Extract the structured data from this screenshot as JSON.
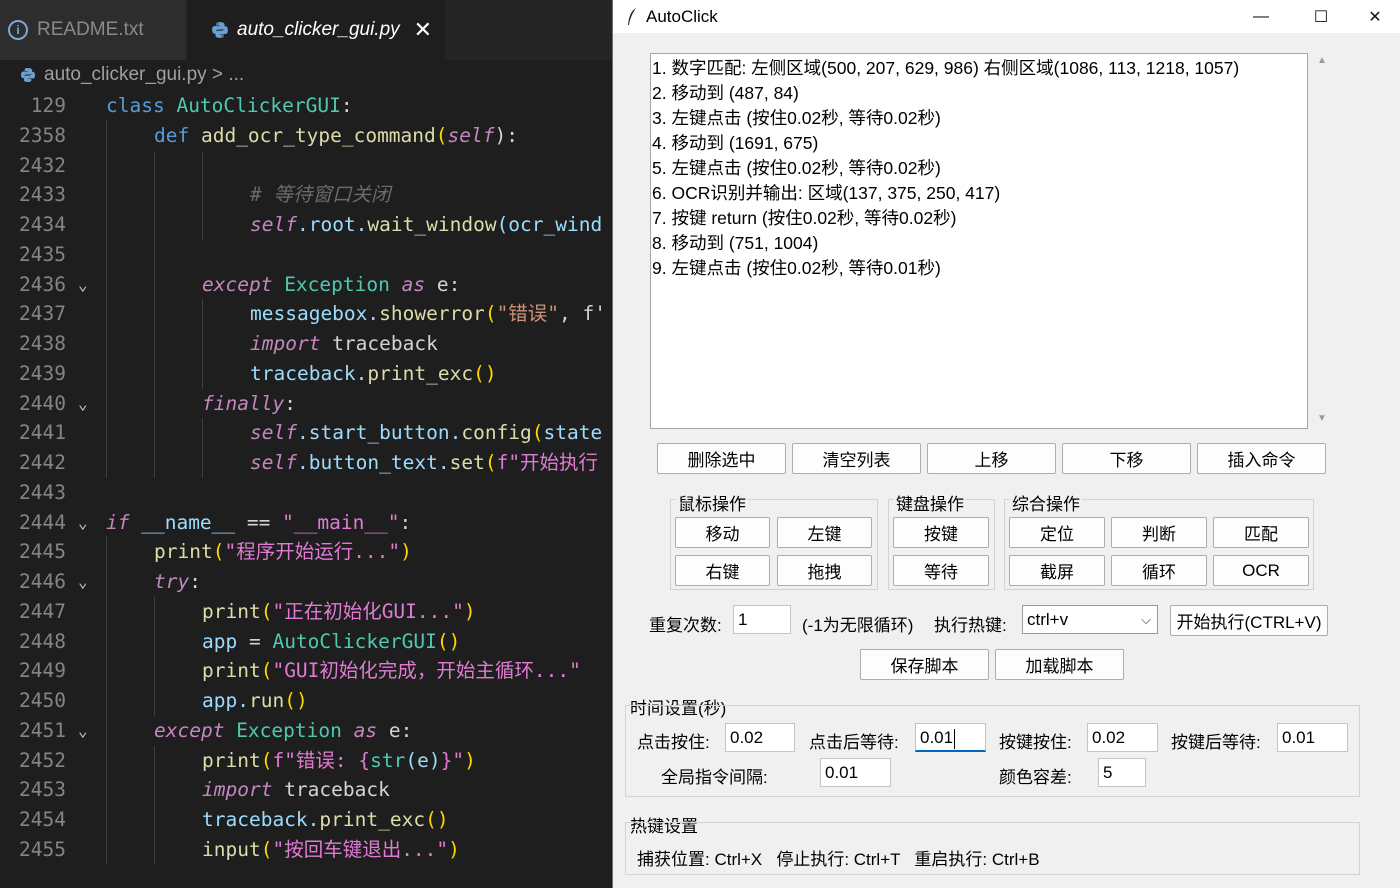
{
  "editor": {
    "tabs": [
      {
        "label": "README.txt"
      },
      {
        "label": "auto_clicker_gui.py"
      }
    ],
    "breadcrumb": {
      "file": "auto_clicker_gui.py",
      "sep": " > ",
      "rest": "..."
    },
    "lines": [
      {
        "num": "129",
        "fold": "",
        "indent": 0,
        "tokens": [
          [
            "class ",
            "c-kw"
          ],
          [
            "AutoClickerGUI",
            "c-cls"
          ],
          [
            ":",
            ""
          ]
        ]
      },
      {
        "num": "2358",
        "fold": "",
        "indent": 1,
        "tokens": [
          [
            "def ",
            "c-kw"
          ],
          [
            "add_ocr_type_command",
            "c-fn"
          ],
          [
            "(",
            "c-par"
          ],
          [
            "self",
            "c-self"
          ],
          [
            "):",
            ""
          ]
        ]
      },
      {
        "num": "2432",
        "fold": "",
        "indent": 3,
        "tokens": []
      },
      {
        "num": "2433",
        "fold": "",
        "indent": 3,
        "tokens": [
          [
            "# 等待窗口关闭",
            "c-cmt"
          ]
        ]
      },
      {
        "num": "2434",
        "fold": "",
        "indent": 3,
        "tokens": [
          [
            "self",
            "c-self"
          ],
          [
            ".root.",
            "c-var"
          ],
          [
            "wait_window",
            "c-fn"
          ],
          [
            "(ocr_wind",
            "c-var"
          ]
        ]
      },
      {
        "num": "2435",
        "fold": "",
        "indent": 2,
        "tokens": []
      },
      {
        "num": "2436",
        "fold": "v",
        "indent": 2,
        "tokens": [
          [
            "except ",
            "c-kwi"
          ],
          [
            "Exception ",
            "c-cls"
          ],
          [
            "as ",
            "c-kwi"
          ],
          [
            "e",
            ""
          ],
          [
            ":",
            ""
          ]
        ]
      },
      {
        "num": "2437",
        "fold": "",
        "indent": 3,
        "tokens": [
          [
            "messagebox.",
            "c-var"
          ],
          [
            "showerror",
            "c-fn"
          ],
          [
            "(",
            "c-par"
          ],
          [
            "\"错误\"",
            "c-str"
          ],
          [
            ", f'",
            ""
          ]
        ]
      },
      {
        "num": "2438",
        "fold": "",
        "indent": 3,
        "tokens": [
          [
            "import ",
            "c-kwi"
          ],
          [
            "traceback",
            ""
          ]
        ]
      },
      {
        "num": "2439",
        "fold": "",
        "indent": 3,
        "tokens": [
          [
            "traceback.",
            "c-var"
          ],
          [
            "print_exc",
            "c-fn"
          ],
          [
            "()",
            "c-par"
          ]
        ]
      },
      {
        "num": "2440",
        "fold": "v",
        "indent": 2,
        "tokens": [
          [
            "finally",
            "c-kwi"
          ],
          [
            ":",
            ""
          ]
        ]
      },
      {
        "num": "2441",
        "fold": "",
        "indent": 3,
        "tokens": [
          [
            "self",
            "c-self"
          ],
          [
            ".start_button.",
            "c-var"
          ],
          [
            "config",
            "c-fn"
          ],
          [
            "(",
            "c-par"
          ],
          [
            "state",
            "c-var"
          ]
        ]
      },
      {
        "num": "2442",
        "fold": "",
        "indent": 3,
        "tokens": [
          [
            "self",
            "c-self"
          ],
          [
            ".button_text.",
            "c-var"
          ],
          [
            "set",
            "c-fn"
          ],
          [
            "(",
            "c-par"
          ],
          [
            "f\"开始执行",
            "c-strp"
          ]
        ]
      },
      {
        "num": "2443",
        "fold": "",
        "indent": 0,
        "tokens": []
      },
      {
        "num": "2444",
        "fold": "v",
        "indent": 0,
        "tokens": [
          [
            "if ",
            "c-kwi"
          ],
          [
            "__name__ ",
            "c-var"
          ],
          [
            "== ",
            ""
          ],
          [
            "\"__main__\"",
            "c-strp"
          ],
          [
            ":",
            ""
          ]
        ]
      },
      {
        "num": "2445",
        "fold": "",
        "indent": 1,
        "tokens": [
          [
            "print",
            "c-fn"
          ],
          [
            "(",
            "c-par"
          ],
          [
            "\"程序开始运行...\"",
            "c-strp"
          ],
          [
            ")",
            "c-par"
          ]
        ]
      },
      {
        "num": "2446",
        "fold": "v",
        "indent": 1,
        "tokens": [
          [
            "try",
            "c-kwi"
          ],
          [
            ":",
            ""
          ]
        ]
      },
      {
        "num": "2447",
        "fold": "",
        "indent": 2,
        "tokens": [
          [
            "print",
            "c-fn"
          ],
          [
            "(",
            "c-par"
          ],
          [
            "\"正在初始化GUI...\"",
            "c-strp"
          ],
          [
            ")",
            "c-par"
          ]
        ]
      },
      {
        "num": "2448",
        "fold": "",
        "indent": 2,
        "tokens": [
          [
            "app ",
            "c-var"
          ],
          [
            "= ",
            ""
          ],
          [
            "AutoClickerGUI",
            "c-cls"
          ],
          [
            "()",
            "c-par"
          ]
        ]
      },
      {
        "num": "2449",
        "fold": "",
        "indent": 2,
        "tokens": [
          [
            "print",
            "c-fn"
          ],
          [
            "(",
            "c-par"
          ],
          [
            "\"GUI初始化完成，开始主循环...\"",
            "c-strp"
          ]
        ]
      },
      {
        "num": "2450",
        "fold": "",
        "indent": 2,
        "tokens": [
          [
            "app.",
            "c-var"
          ],
          [
            "run",
            "c-fn"
          ],
          [
            "()",
            "c-par"
          ]
        ]
      },
      {
        "num": "2451",
        "fold": "v",
        "indent": 1,
        "tokens": [
          [
            "except ",
            "c-kwi"
          ],
          [
            "Exception ",
            "c-cls"
          ],
          [
            "as ",
            "c-kwi"
          ],
          [
            "e",
            ""
          ],
          [
            ":",
            ""
          ]
        ]
      },
      {
        "num": "2452",
        "fold": "",
        "indent": 2,
        "tokens": [
          [
            "print",
            "c-fn"
          ],
          [
            "(",
            "c-par"
          ],
          [
            "f\"错误: {",
            "c-strp"
          ],
          [
            "str",
            "c-cls"
          ],
          [
            "(e)",
            "c-var"
          ],
          [
            "}\"",
            "c-strp"
          ],
          [
            ")",
            "c-par"
          ]
        ]
      },
      {
        "num": "2453",
        "fold": "",
        "indent": 2,
        "tokens": [
          [
            "import ",
            "c-kwi"
          ],
          [
            "traceback",
            ""
          ]
        ]
      },
      {
        "num": "2454",
        "fold": "",
        "indent": 2,
        "tokens": [
          [
            "traceback.",
            "c-var"
          ],
          [
            "print_exc",
            "c-fn"
          ],
          [
            "()",
            "c-par"
          ]
        ]
      },
      {
        "num": "2455",
        "fold": "",
        "indent": 2,
        "tokens": [
          [
            "input",
            "c-fn"
          ],
          [
            "(",
            "c-par"
          ],
          [
            "\"按回车键退出...\"",
            "c-strp"
          ],
          [
            ")",
            "c-par"
          ]
        ]
      }
    ]
  },
  "window": {
    "title": "AutoClick",
    "controls": {
      "minimize": "—",
      "maximize": "☐",
      "close": "✕"
    },
    "commands": [
      "1. 数字匹配: 左侧区域(500, 207, 629, 986) 右侧区域(1086, 113, 1218, 1057)",
      "2. 移动到 (487, 84)",
      "3. 左键点击 (按住0.02秒, 等待0.02秒)",
      "4. 移动到 (1691, 675)",
      "5. 左键点击 (按住0.02秒, 等待0.02秒)",
      "6. OCR识别并输出: 区域(137, 375, 250, 417)",
      "7. 按键 return (按住0.02秒, 等待0.02秒)",
      "8. 移动到 (751, 1004)",
      "9. 左键点击 (按住0.02秒, 等待0.01秒)"
    ],
    "list_buttons": {
      "delete": "删除选中",
      "clear": "清空列表",
      "up": "上移",
      "down": "下移",
      "insert": "插入命令"
    },
    "mouse_group": {
      "title": "鼠标操作",
      "move": "移动",
      "left": "左键",
      "right": "右键",
      "drag": "拖拽"
    },
    "keyboard_group": {
      "title": "键盘操作",
      "key": "按键",
      "wait": "等待"
    },
    "combo_group": {
      "title": "综合操作",
      "locate": "定位",
      "judge": "判断",
      "match": "匹配",
      "screenshot": "截屏",
      "loop": "循环",
      "ocr": "OCR"
    },
    "repeat": {
      "label": "重复次数:",
      "value": "1",
      "hint": "(-1为无限循环)"
    },
    "hotkey": {
      "label": "执行热键:",
      "value": "ctrl+v"
    },
    "start_button": "开始执行(CTRL+V)",
    "save_button": "保存脚本",
    "load_button": "加载脚本",
    "timing": {
      "title": "时间设置(秒)",
      "click_hold_label": "点击按住:",
      "click_hold": "0.02",
      "after_click_label": "点击后等待:",
      "after_click": "0.01",
      "key_hold_label": "按键按住:",
      "key_hold": "0.02",
      "after_key_label": "按键后等待:",
      "after_key": "0.01",
      "interval_label": "全局指令间隔:",
      "interval": "0.01",
      "tolerance_label": "颜色容差:",
      "tolerance": "5"
    },
    "hotkeys": {
      "title": "热键设置",
      "text": "捕获位置: Ctrl+X   停止执行: Ctrl+T   重启执行: Ctrl+B"
    }
  }
}
